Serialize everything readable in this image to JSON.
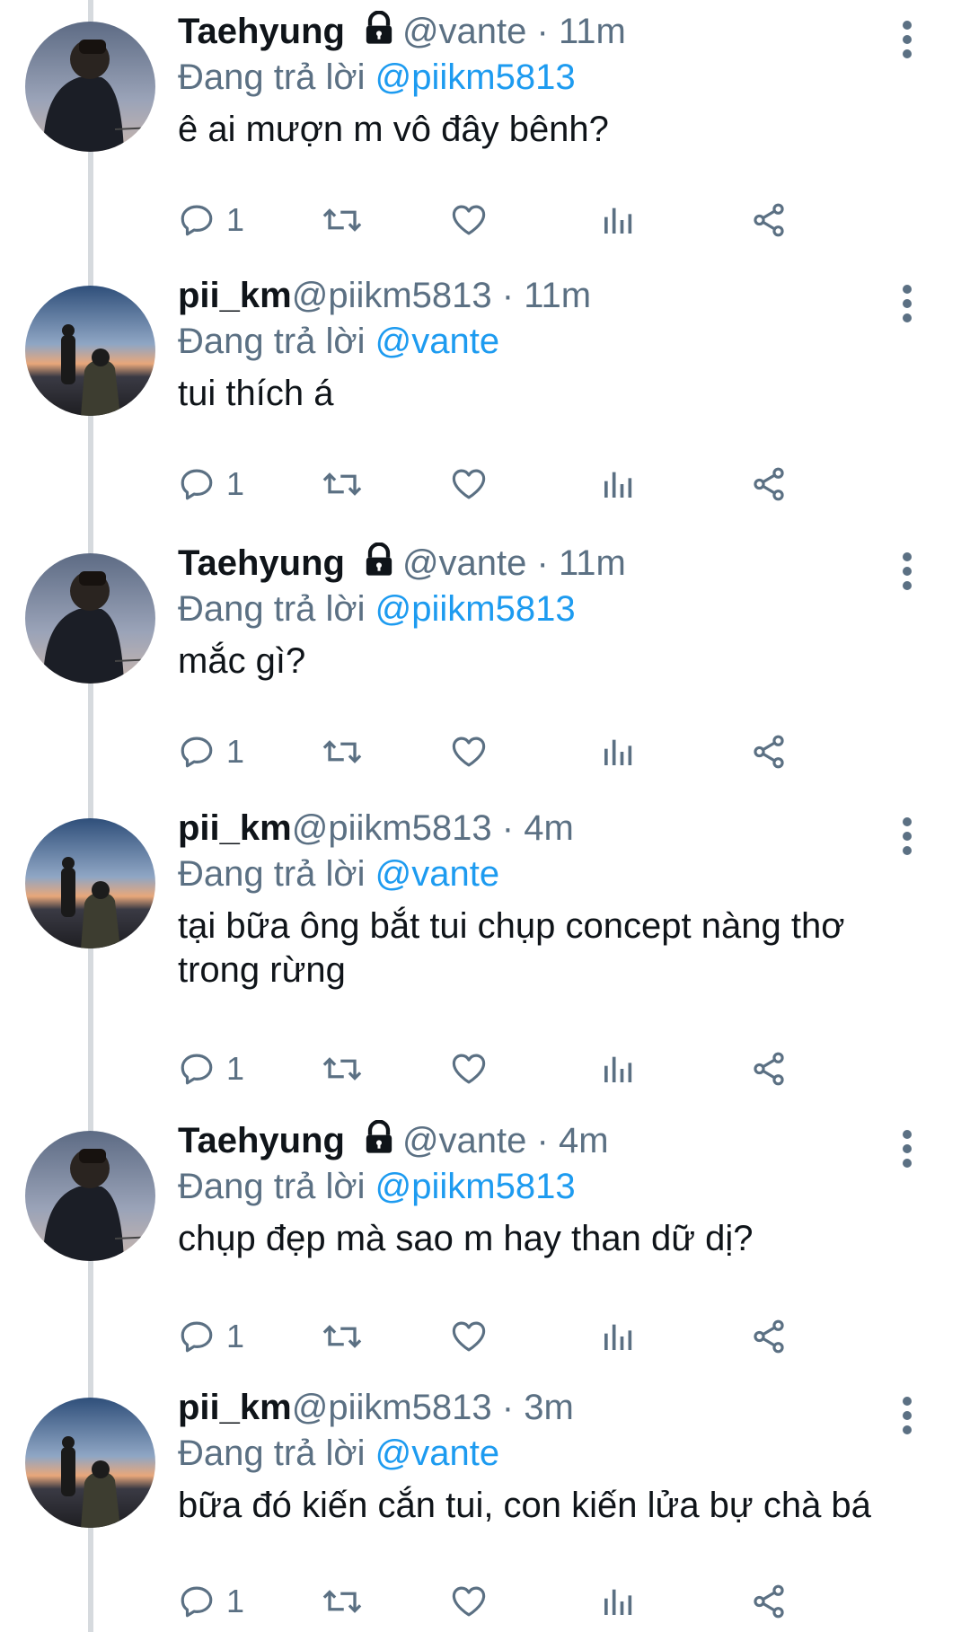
{
  "colors": {
    "accent": "#1d9bf0",
    "secondary_text": "#5b7083",
    "thread_line": "#d6dade"
  },
  "icons": {
    "lock": "lock-icon",
    "more": "more-vertical-icon",
    "reply": "reply-icon",
    "retweet": "retweet-icon",
    "like": "heart-icon",
    "analytics": "analytics-icon",
    "share": "share-icon"
  },
  "tweets": [
    {
      "name": "Taehyung",
      "handle": "@vante",
      "dot": "·",
      "time": "11m",
      "locked": true,
      "replying_prefix": "Đang trả lời",
      "replying_to": "@piikm5813",
      "text": "ê ai mượn m vô đây bênh?",
      "reply_count": "1"
    },
    {
      "name": "pii_km",
      "handle": "@piikm5813",
      "dot": "·",
      "time": "11m",
      "locked": false,
      "replying_prefix": "Đang trả lời",
      "replying_to": "@vante",
      "text": "tui thích á",
      "reply_count": "1"
    },
    {
      "name": "Taehyung",
      "handle": "@vante",
      "dot": "·",
      "time": "11m",
      "locked": true,
      "replying_prefix": "Đang trả lời",
      "replying_to": "@piikm5813",
      "text": "mắc gì?",
      "reply_count": "1"
    },
    {
      "name": "pii_km",
      "handle": "@piikm5813",
      "dot": "·",
      "time": "4m",
      "locked": false,
      "replying_prefix": "Đang trả lời",
      "replying_to": "@vante",
      "text": "tại bữa ông bắt tui chụp concept nàng thơ\ntrong rừng",
      "reply_count": "1"
    },
    {
      "name": "Taehyung",
      "handle": "@vante",
      "dot": "·",
      "time": "4m",
      "locked": true,
      "replying_prefix": "Đang trả lời",
      "replying_to": "@piikm5813",
      "text": "chụp đẹp mà sao m hay than dữ dị?",
      "reply_count": "1"
    },
    {
      "name": "pii_km",
      "handle": "@piikm5813",
      "dot": "·",
      "time": "3m",
      "locked": false,
      "replying_prefix": "Đang trả lời",
      "replying_to": "@vante",
      "text": "bữa đó kiến cắn tui, con kiến lửa bự chà bá",
      "reply_count": "1"
    }
  ]
}
